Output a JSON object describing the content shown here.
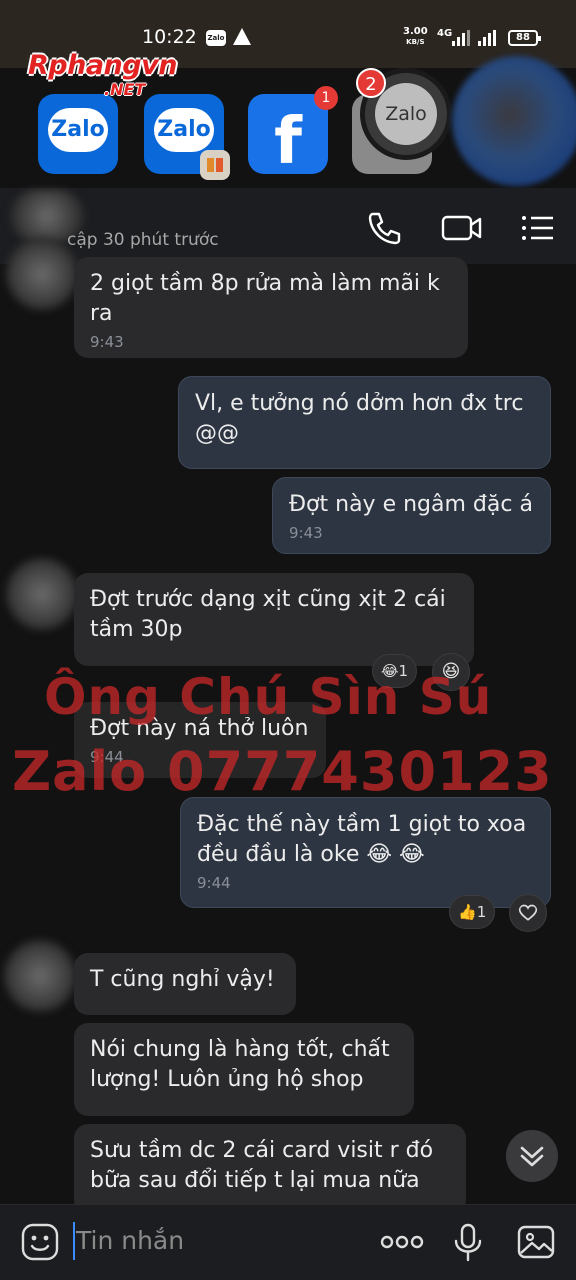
{
  "status_bar": {
    "time": "10:22",
    "net_speed_value": "3.00",
    "net_speed_unit": "KB/S",
    "network": "4G",
    "battery": "88"
  },
  "watermark_logo": {
    "main": "Rphangvn",
    "suffix": ".NET"
  },
  "recent_apps": [
    {
      "name": "zalo-app",
      "label": "Zalo",
      "badge": ""
    },
    {
      "name": "zalo-app-clone",
      "label": "Zalo",
      "badge": ""
    },
    {
      "name": "facebook-app",
      "label": "f",
      "badge": "1"
    },
    {
      "name": "zalo-floating-bubble",
      "label": "Zalo",
      "badge": "2"
    }
  ],
  "chat": {
    "last_seen": "cập 30 phút trước"
  },
  "messages": [
    {
      "dir": "in",
      "text": "2 giọt tầm 8p rửa mà làm mãi k ra",
      "time": "9:43"
    },
    {
      "dir": "out",
      "text": "Vl, e tưởng nó dởm hơn đx trc @@",
      "time": ""
    },
    {
      "dir": "out",
      "text": "Đợt này e ngâm đặc á",
      "time": "9:43"
    },
    {
      "dir": "in",
      "text": "Đợt trước dạng xịt cũng xịt 2 cái tầm 30p",
      "time": "",
      "reaction": "1"
    },
    {
      "dir": "in",
      "text": "Đợt này ná thở luôn",
      "time": "9:44"
    },
    {
      "dir": "out",
      "text": "Đặc thế này tầm 1 giọt to xoa đều đầu là oke 😂 😂",
      "time": "9:44",
      "reaction": "1"
    },
    {
      "dir": "in",
      "text": "T cũng nghỉ vậy!",
      "time": ""
    },
    {
      "dir": "in",
      "text": "Nói chung là hàng tốt, chất lượng! Luôn ủng hộ shop",
      "time": ""
    },
    {
      "dir": "in",
      "text": "Sưu tầm dc 2 cái card visit r đó bữa sau đổi tiếp t lại mua nữa",
      "time": ""
    }
  ],
  "watermark_text": {
    "line1": "Ông Chú Sìn Sú",
    "line2": "Zalo 0777430123"
  },
  "input": {
    "placeholder": "Tin nhắn"
  },
  "colors": {
    "background": "#121212",
    "incoming_bubble": "#2a2a2c",
    "outgoing_bubble": "#2d3542",
    "watermark_red": "#c82828"
  }
}
